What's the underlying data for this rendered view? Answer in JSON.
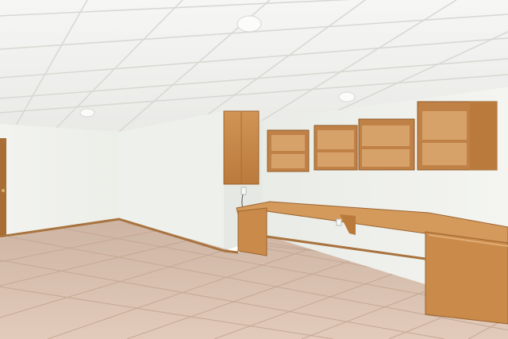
{
  "scene": {
    "ceiling_tile_color": "#f3f3f1",
    "ceiling_grid_color": "#dcdcd8",
    "wall_color": "#f1f2ee",
    "wall_shadow_color": "#e6e7e2",
    "floor_tile_color": "#d8bfae",
    "floor_grout_color": "#c8ad9a",
    "wood_color": "#c98a4a",
    "wood_dark_color": "#a86e35",
    "baseboard_color": "#b07a45"
  }
}
